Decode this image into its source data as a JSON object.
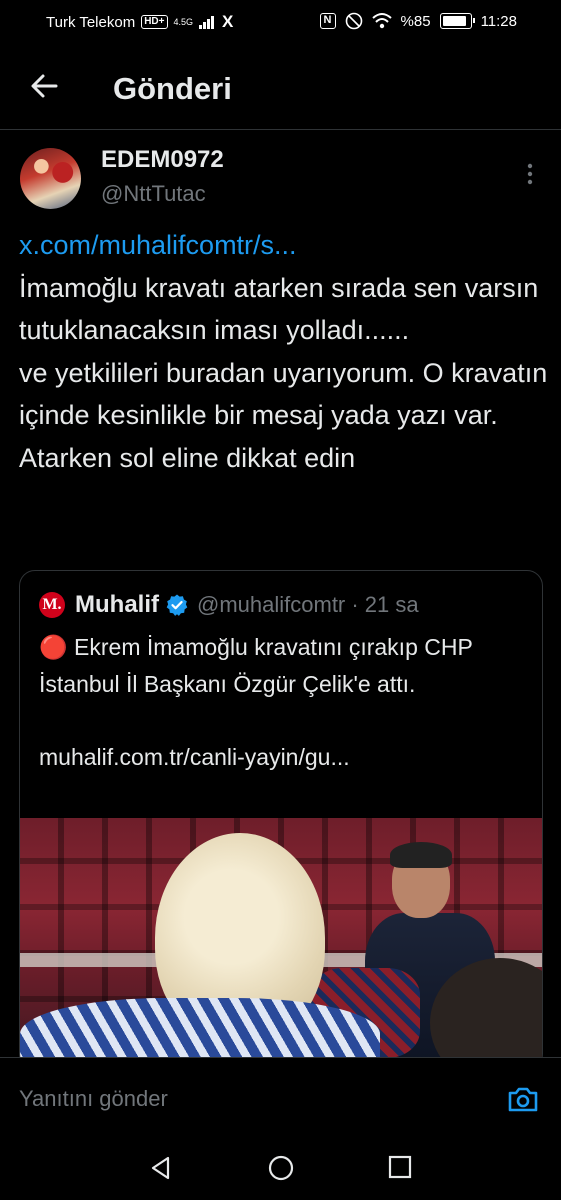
{
  "status_bar": {
    "carrier": "Turk Telekom",
    "hd": "HD+",
    "network": "4.5G",
    "battery": "%85",
    "time": "11:28",
    "x_app": "X"
  },
  "header": {
    "title": "Gönderi",
    "back_icon": "arrow-left-icon"
  },
  "tweet": {
    "display_name": "EDEM0972",
    "handle": "@NttTutac",
    "link": "x.com/muhalifcomtr/s...",
    "text": "İmamoğlu kravatı atarken sırada sen varsın tutuklanacaksın iması yolladı......\nve yetkilileri buradan uyarıyorum. O kravatın içinde kesinlikle bir mesaj yada yazı var. Atarken sol eline dikkat edin"
  },
  "quote": {
    "logo_letter": "M.",
    "name": "Muhalif",
    "handle_time": "@muhalifcomtr · 21 sa",
    "text": "🔴 Ekrem İmamoğlu kravatını çırakıp CHP İstanbul İl Başkanı Özgür Çelik'e attı.\n\nmuhalif.com.tr/canli-yayin/gu...",
    "verified_color": "#1d9bf0"
  },
  "reply": {
    "placeholder": "Yanıtını gönder"
  },
  "colors": {
    "accent": "#1d9bf0",
    "text": "#e7e9ea",
    "muted": "#71767b",
    "border": "#2f3336"
  }
}
